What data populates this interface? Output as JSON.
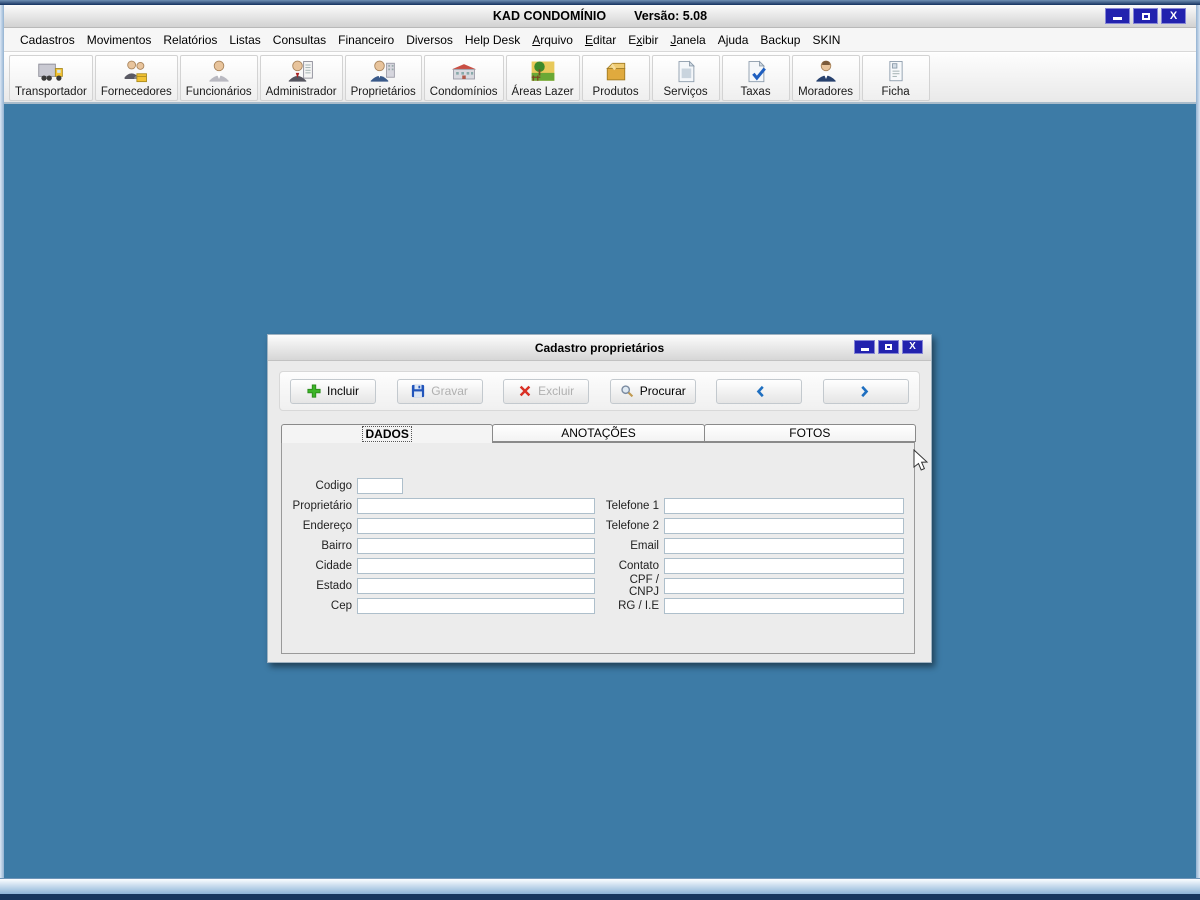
{
  "window": {
    "title": "KAD CONDOMÍNIO",
    "version": "Versão: 5.08",
    "close_glyph": "X"
  },
  "menu": {
    "items": [
      {
        "pre": "Cadastros",
        "accel": "",
        "post": ""
      },
      {
        "pre": "Movimentos",
        "accel": "",
        "post": ""
      },
      {
        "pre": "Relatórios",
        "accel": "",
        "post": ""
      },
      {
        "pre": "Listas",
        "accel": "",
        "post": ""
      },
      {
        "pre": "Consultas",
        "accel": "",
        "post": ""
      },
      {
        "pre": "Financeiro",
        "accel": "",
        "post": ""
      },
      {
        "pre": "Diversos",
        "accel": "",
        "post": ""
      },
      {
        "pre": "Help Desk",
        "accel": "",
        "post": ""
      },
      {
        "pre": "",
        "accel": "A",
        "post": "rquivo"
      },
      {
        "pre": "",
        "accel": "E",
        "post": "ditar"
      },
      {
        "pre": "E",
        "accel": "x",
        "post": "ibir"
      },
      {
        "pre": "",
        "accel": "J",
        "post": "anela"
      },
      {
        "pre": "Ajuda",
        "accel": "",
        "post": ""
      },
      {
        "pre": "Backup",
        "accel": "",
        "post": ""
      },
      {
        "pre": "SKIN",
        "accel": "",
        "post": ""
      }
    ]
  },
  "toolbar": {
    "buttons": [
      {
        "label": "Transportador",
        "icon": "truck-icon"
      },
      {
        "label": "Fornecedores",
        "icon": "suppliers-icon"
      },
      {
        "label": "Funcionários",
        "icon": "employee-icon"
      },
      {
        "label": "Administrador",
        "icon": "administrator-icon"
      },
      {
        "label": "Proprietários",
        "icon": "owner-icon"
      },
      {
        "label": "Condomínios",
        "icon": "condo-building-icon"
      },
      {
        "label": "Áreas Lazer",
        "icon": "leisure-area-icon"
      },
      {
        "label": "Produtos",
        "icon": "products-box-icon"
      },
      {
        "label": "Serviços",
        "icon": "services-document-icon"
      },
      {
        "label": "Taxas",
        "icon": "taxes-check-icon"
      },
      {
        "label": "Moradores",
        "icon": "resident-icon"
      },
      {
        "label": "Ficha",
        "icon": "record-card-icon"
      }
    ]
  },
  "dialog": {
    "title": "Cadastro proprietários",
    "close_glyph": "X",
    "toolbar": {
      "incluir": "Incluir",
      "gravar": "Gravar",
      "excluir": "Excluir",
      "procurar": "Procurar"
    },
    "tabs": [
      {
        "label": "DADOS",
        "active": true
      },
      {
        "label": "ANOTAÇÕES",
        "active": false
      },
      {
        "label": "FOTOS",
        "active": false
      }
    ],
    "fields": {
      "codigo": {
        "label": "Codigo",
        "value": ""
      },
      "proprietario": {
        "label": "Proprietário",
        "value": ""
      },
      "endereco": {
        "label": "Endereço",
        "value": ""
      },
      "bairro": {
        "label": "Bairro",
        "value": ""
      },
      "cidade": {
        "label": "Cidade",
        "value": ""
      },
      "estado": {
        "label": "Estado",
        "value": ""
      },
      "cep": {
        "label": "Cep",
        "value": ""
      },
      "telefone1": {
        "label": "Telefone 1",
        "value": ""
      },
      "telefone2": {
        "label": "Telefone 2",
        "value": ""
      },
      "email": {
        "label": "Email",
        "value": ""
      },
      "contato": {
        "label": "Contato",
        "value": ""
      },
      "cpf_cnpj": {
        "label": "CPF / CNPJ",
        "value": ""
      },
      "rg_ie": {
        "label": "RG / I.E",
        "value": ""
      }
    }
  },
  "colors": {
    "client_background": "#3d7ba6",
    "control_button_navy": "#2222ae",
    "dialog_background": "#ebebeb",
    "incluir_green": "#3db528",
    "excluir_red": "#d93025",
    "gravar_blue": "#2255bb",
    "nav_arrow_blue": "#1f6fc0"
  }
}
